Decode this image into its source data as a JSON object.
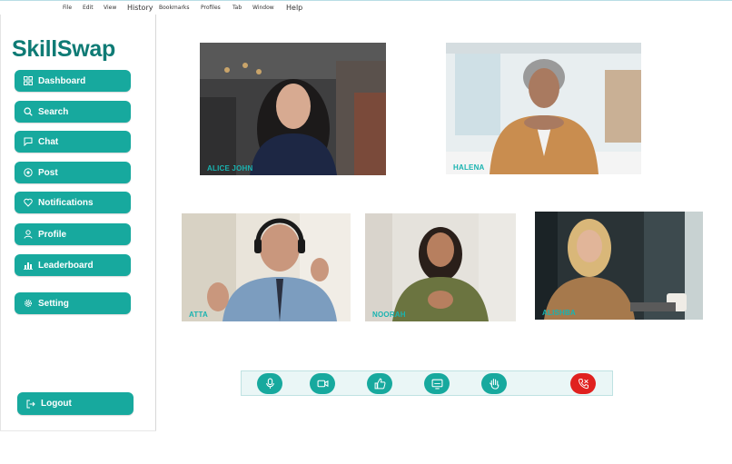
{
  "menu": {
    "items": [
      "File",
      "Edit",
      "View",
      "History",
      "Bookmarks",
      "Profiles",
      "Tab",
      "Window",
      "Help"
    ]
  },
  "sidebar": {
    "brand": "SkillSwap",
    "items": [
      {
        "label": "Dashboard",
        "icon": "grid-icon"
      },
      {
        "label": "Search",
        "icon": "search-icon"
      },
      {
        "label": "Chat",
        "icon": "chat-icon"
      },
      {
        "label": "Post",
        "icon": "eye-icon"
      },
      {
        "label": "Notifications",
        "icon": "heart-icon"
      },
      {
        "label": "Profile",
        "icon": "user-icon"
      },
      {
        "label": "Leaderboard",
        "icon": "bar-chart-icon"
      },
      {
        "label": "Setting",
        "icon": "gear-icon"
      }
    ],
    "logout": {
      "label": "Logout",
      "icon": "logout-icon"
    }
  },
  "participants": [
    {
      "name": "ALICE JOHN"
    },
    {
      "name": "HALENA"
    },
    {
      "name": "ATTA"
    },
    {
      "name": "NOORAH"
    },
    {
      "name": "ALISHBA"
    }
  ],
  "controls": [
    {
      "icon": "microphone-icon"
    },
    {
      "icon": "video-camera-icon"
    },
    {
      "icon": "thumbs-up-icon"
    },
    {
      "icon": "screen-share-icon"
    },
    {
      "icon": "raise-hand-icon"
    },
    {
      "icon": "end-call-icon"
    }
  ],
  "colors": {
    "brand": "#0f7b75",
    "accent": "#17a99e",
    "name_label": "#19b3b0",
    "end_call": "#e0211f"
  }
}
